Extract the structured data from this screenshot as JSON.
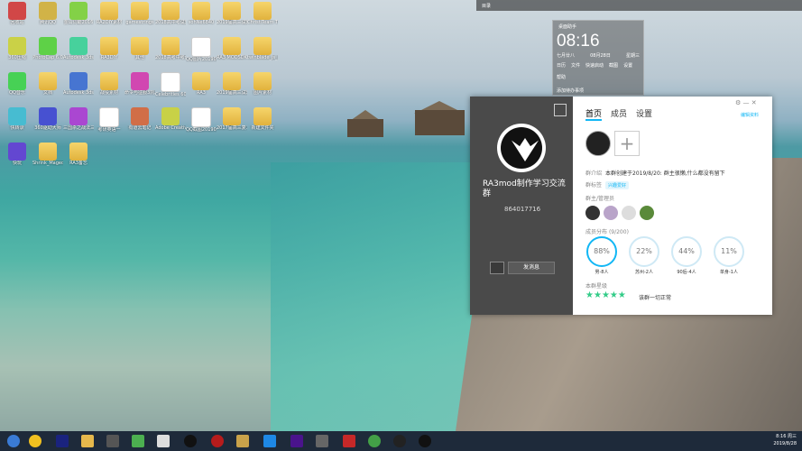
{
  "topbar": {
    "label": "目录"
  },
  "widget": {
    "title": "桌面助手",
    "time": "08:16",
    "date_items": [
      "七月廿八",
      "08月28日",
      "星期三"
    ],
    "buttons": [
      "日历",
      "文件",
      "快速启动",
      "截图",
      "设置",
      "帮助"
    ],
    "footer": "添加待办事项"
  },
  "desktop_icons": [
    {
      "label": "回收站",
      "type": "app"
    },
    {
      "label": "腾讯QQ",
      "type": "app"
    },
    {
      "label": "金山词霸2016",
      "type": "app"
    },
    {
      "label": "RA2DIY素材",
      "type": "folder"
    },
    {
      "label": "gamestrings",
      "type": "folder"
    },
    {
      "label": "2018高中考试题研究...",
      "type": "folder"
    },
    {
      "label": "sohNe6840",
      "type": "folder"
    },
    {
      "label": "2019届高三试题研究复习...",
      "type": "folder"
    },
    {
      "label": "ChristiTeam The Worm",
      "type": "folder"
    },
    {
      "label": "360压缩",
      "type": "app"
    },
    {
      "label": "PhotoCap 6.0",
      "type": "app"
    },
    {
      "label": "Autodesk 3ds Max",
      "type": "app"
    },
    {
      "label": "RA3DIY",
      "type": "folder"
    },
    {
      "label": "其他",
      "type": "folder"
    },
    {
      "label": "2018高考中考试题研究",
      "type": "folder"
    },
    {
      "label": "QQ图片20190815",
      "type": "doc"
    },
    {
      "label": "RA3 MODSDK",
      "type": "folder"
    },
    {
      "label": "twinblade_js_beta",
      "type": "folder"
    },
    {
      "label": "QQ音乐",
      "type": "app"
    },
    {
      "label": "文档",
      "type": "folder"
    },
    {
      "label": "Autodesk 3ds Max建筑...",
      "type": "app"
    },
    {
      "label": "战役素材",
      "type": "folder"
    },
    {
      "label": "命令与征服3凯恩之怒",
      "type": "app"
    },
    {
      "label": "Celebrities 6065529b",
      "type": "doc"
    },
    {
      "label": "RA3",
      "type": "folder"
    },
    {
      "label": "2019届高三试题研究...",
      "type": "folder"
    },
    {
      "label": "图片素材",
      "type": "folder"
    },
    {
      "label": "快转录",
      "type": "app"
    },
    {
      "label": "360驱动大师",
      "type": "app"
    },
    {
      "label": "三国杀之战法三十人",
      "type": "app"
    },
    {
      "label": "考研英语一",
      "type": "doc"
    },
    {
      "label": "有道云笔记",
      "type": "app"
    },
    {
      "label": "Adobe Creative Cloud",
      "type": "app"
    },
    {
      "label": "QQ截图20190815",
      "type": "doc"
    },
    {
      "label": "2017届高三复习研究",
      "type": "folder"
    },
    {
      "label": "新建文件夹",
      "type": "folder"
    },
    {
      "label": "快玩",
      "type": "app"
    },
    {
      "label": "Shrink_Mageddon",
      "type": "folder"
    },
    {
      "label": "RA3备忘",
      "type": "folder"
    }
  ],
  "group_card": {
    "group_name": "RA3mod制作学习交流群",
    "group_number": "864017716",
    "send_button": "发消息",
    "tabs": [
      "首页",
      "成员",
      "设置"
    ],
    "edit_link": "编辑资料",
    "intro_key": "群介绍",
    "intro_value": "本群创建于2019/8/20: 群主很懒,什么都没有留下",
    "tag_key": "群标签",
    "tag_value": "兴趣爱好",
    "admins_label": "群主/管理员",
    "distribution_label": "成员分布",
    "distribution_count": "(9/200)",
    "stats": [
      {
        "pct": "88%",
        "label": "男-8人"
      },
      {
        "pct": "22%",
        "label": "苏州-2人"
      },
      {
        "pct": "44%",
        "label": "90后-4人"
      },
      {
        "pct": "11%",
        "label": "单身-1人"
      }
    ],
    "rating_label": "本群星级",
    "rating_stars": 5,
    "rating_note": "该群一切正常"
  },
  "taskbar": {
    "time": "8:16 周三",
    "date": "2019/8/28"
  }
}
